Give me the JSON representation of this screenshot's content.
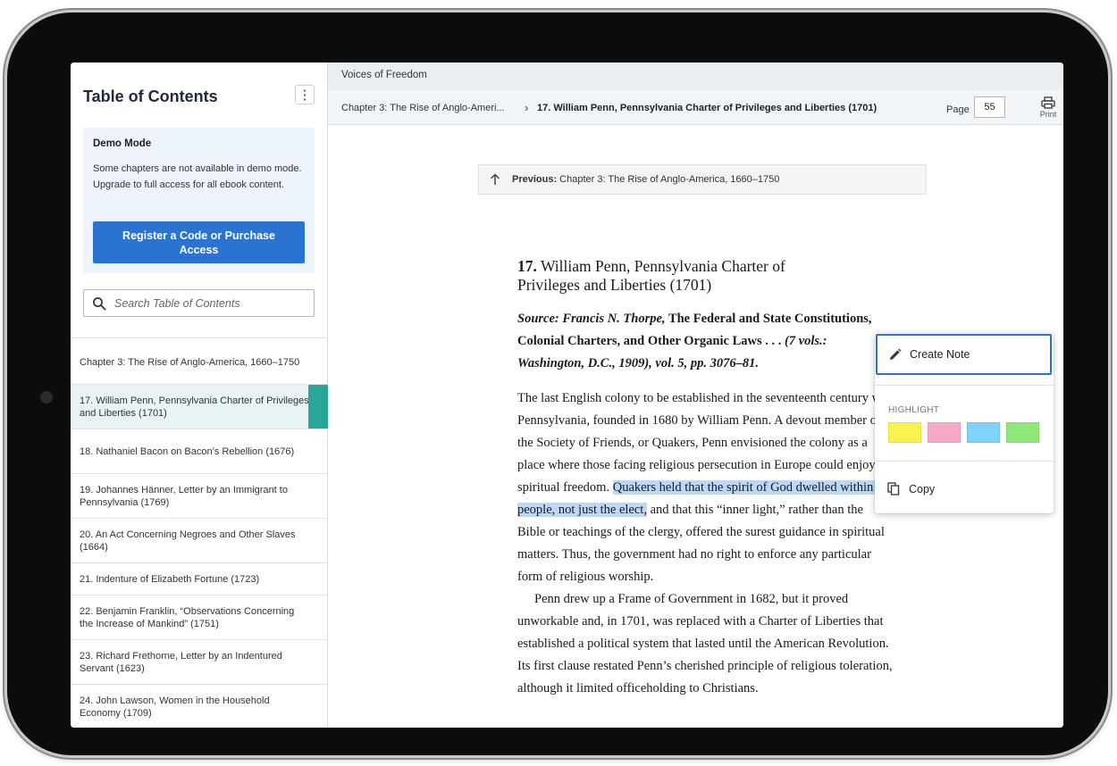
{
  "sidebar": {
    "title": "Table of Contents",
    "more_icon": "kebab-vertical-icon",
    "demo": {
      "title": "Demo Mode",
      "text": "Some chapters are not available in demo mode. Upgrade to full access for all ebook content.",
      "button_label": "Register a Code or Purchase Access"
    },
    "search": {
      "placeholder": "Search Table of Contents",
      "value": ""
    },
    "items": [
      {
        "label": "Chapter 3: The Rise of Anglo-America, 1660–1750"
      },
      {
        "label": "17. William Penn, Pennsylvania Charter of Privileges and Liberties (1701)",
        "active": true
      },
      {
        "label": "18. Nathaniel Bacon on Bacon’s Rebellion (1676)"
      },
      {
        "label": "19. Johannes Hänner, Letter by an Immigrant to Pennsylvania (1769)"
      },
      {
        "label": "20. An Act Concerning Negroes and Other Slaves (1664)"
      },
      {
        "label": "21. Indenture of Elizabeth Fortune (1723)"
      },
      {
        "label": "22. Benjamin Franklin, “Observations Concerning the Increase of Mankind” (1751)"
      },
      {
        "label": "23. Richard Frethorne, Letter by an Indentured Servant (1623)"
      },
      {
        "label": "24. John Lawson, Women in the Household Economy (1709)"
      }
    ]
  },
  "header": {
    "book_title": "Voices of Freedom",
    "breadcrumb_chapter": "Chapter 3: The Rise of Anglo-Ameri...",
    "breadcrumb_separator": "›",
    "breadcrumb_current": "17. William Penn, Pennsylvania Charter of Privileges and Liberties (1701)",
    "page_label": "Page",
    "page_value": "55",
    "print_label": "Print"
  },
  "content": {
    "previous_label": "Previous:",
    "previous_text": "Chapter 3: The Rise of Anglo-America, 1660–1750",
    "title_number": "17.",
    "title_text": "William Penn, Pennsylvania Charter of Privileges and Liberties (1701)",
    "source_prefix": "Source: Francis N. Thorpe,",
    "source_work": "The Federal and State Constitutions, Colonial Charters, and Other Organic Laws . . .",
    "source_suffix": "(7 vols.: Washington, D.C., 1909), vol. 5, pp. 3076–81.",
    "p1_before": "The last English colony to be established in the seventeenth century was Pennsylvania, founded in 1680 by William Penn. A devout member of the Society of Friends, or Quakers, Penn envisioned the colony as a place where those facing religious persecution in Europe could enjoy spiritual freedom. ",
    "p1_highlight": "Quakers held that the spirit of God dwelled within all people, not just the elect,",
    "p1_after": " and that this “inner light,” rather than the Bible or teachings of the clergy, offered the surest guidance in spiritual matters. Thus, the government had no right to enforce any particular form of religious worship.",
    "p2": "Penn drew up a Frame of Government in 1682, but it proved unworkable and, in 1701, was replaced with a Charter of Liberties that established a political system that lasted until the American Revolution. Its first clause restated Penn’s cherished principle of religious toleration, although it limited officeholding to Christians."
  },
  "popup": {
    "create_note_label": "Create Note",
    "highlight_label": "HIGHLIGHT",
    "swatches": [
      "#f9f34f",
      "#f7a9c9",
      "#7fd2f8",
      "#8ee87a"
    ],
    "copy_label": "Copy"
  }
}
